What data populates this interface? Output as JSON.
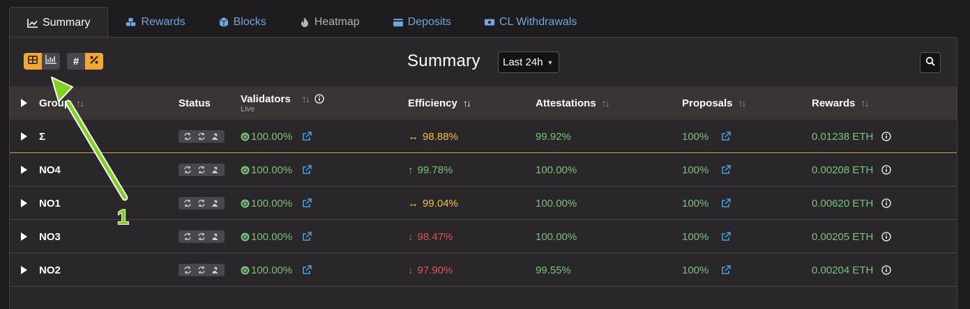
{
  "tabs": [
    {
      "label": "Summary",
      "icon": "chart-line-icon"
    },
    {
      "label": "Rewards",
      "icon": "cubes-icon"
    },
    {
      "label": "Blocks",
      "icon": "cube-icon"
    },
    {
      "label": "Heatmap",
      "icon": "fire-icon"
    },
    {
      "label": "Deposits",
      "icon": "wallet-icon"
    },
    {
      "label": "CL Withdrawals",
      "icon": "money-bill-icon"
    }
  ],
  "toolbar": {
    "title": "Summary",
    "period": "Last 24h",
    "hash_label": "#",
    "accent_color": "#f0a832"
  },
  "table": {
    "headers": {
      "group": "Group",
      "status": "Status",
      "validators": "Validators",
      "validators_sub": "Live",
      "efficiency": "Efficiency",
      "attestations": "Attestations",
      "proposals": "Proposals",
      "rewards": "Rewards"
    },
    "rows": [
      {
        "group": "Σ",
        "validators": "100.00%",
        "eff_arrow": "↔",
        "efficiency": "98.88%",
        "eff_status": "yellow",
        "attestations": "99.92%",
        "proposals": "100%",
        "rewards": "0.01238 ETH"
      },
      {
        "group": "NO4",
        "validators": "100.00%",
        "eff_arrow": "↑",
        "efficiency": "99.78%",
        "eff_status": "green",
        "attestations": "100.00%",
        "proposals": "100%",
        "rewards": "0.00208 ETH"
      },
      {
        "group": "NO1",
        "validators": "100.00%",
        "eff_arrow": "↔",
        "efficiency": "99.04%",
        "eff_status": "yellow",
        "attestations": "100.00%",
        "proposals": "100%",
        "rewards": "0.00620 ETH"
      },
      {
        "group": "NO3",
        "validators": "100.00%",
        "eff_arrow": "↓",
        "efficiency": "98.47%",
        "eff_status": "red",
        "attestations": "100.00%",
        "proposals": "100%",
        "rewards": "0.00205 ETH"
      },
      {
        "group": "NO2",
        "validators": "100.00%",
        "eff_arrow": "↓",
        "efficiency": "97.90%",
        "eff_status": "red",
        "attestations": "99.55%",
        "proposals": "100%",
        "rewards": "0.00204 ETH"
      }
    ]
  },
  "annotation": {
    "label": "1",
    "color": "#7ed321"
  }
}
